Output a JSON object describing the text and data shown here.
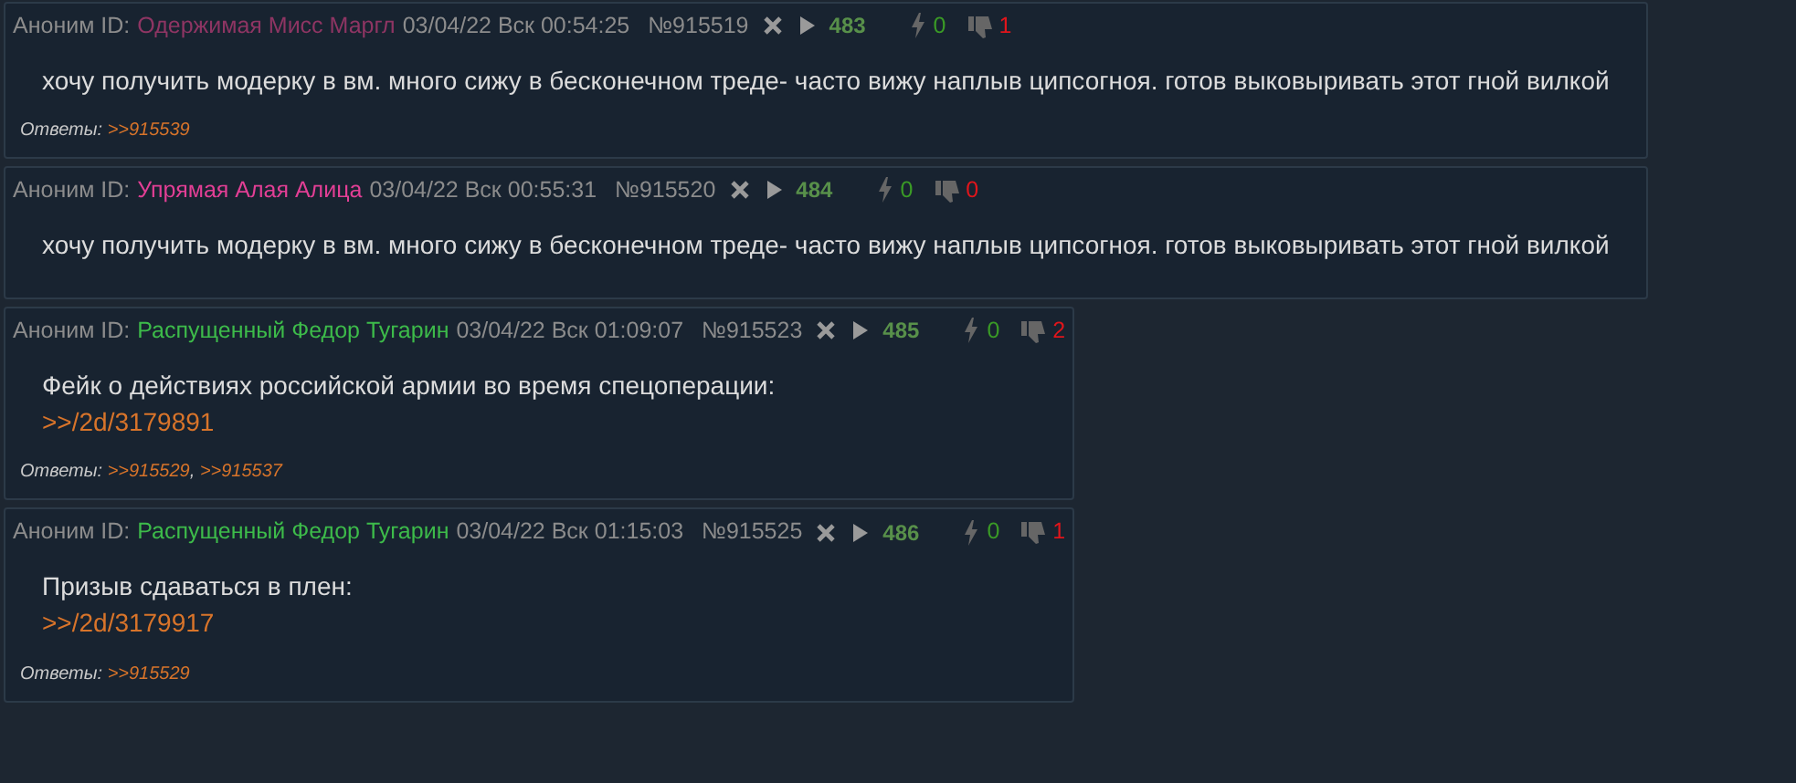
{
  "posts": [
    {
      "author": "Аноним ID:",
      "poster_name": "Одержимая Мисс Маргл",
      "color": "#8e3563",
      "datetime": "03/04/22 Вск 00:54:25",
      "number": "№915519",
      "index": "483",
      "likes": "0",
      "dislikes": "1",
      "body": [
        {
          "kind": "text",
          "text": "хочу получить модерку в вм. много сижу в бесконечном треде- часто вижу наплыв ципсогноя. готов выковыривать этот гной вилкой"
        }
      ],
      "replies_label": "Ответы:",
      "replies": [
        ">>915539"
      ]
    },
    {
      "author": "Аноним ID:",
      "poster_name": "Упрямая Алая Алица",
      "color": "#e23f95",
      "datetime": "03/04/22 Вск 00:55:31",
      "number": "№915520",
      "index": "484",
      "likes": "0",
      "dislikes": "0",
      "body": [
        {
          "kind": "text",
          "text": "хочу получить модерку в вм. много сижу в бесконечном треде- часто вижу наплыв ципсогноя. готов выковыривать этот гной вилкой"
        }
      ]
    },
    {
      "author": "Аноним ID:",
      "poster_name": "Распущенный Федор Тугарин",
      "color": "#3dbb4a",
      "datetime": "03/04/22 Вск 01:09:07",
      "number": "№915523",
      "index": "485",
      "likes": "0",
      "dislikes": "2",
      "body": [
        {
          "kind": "text",
          "text": "Фейк о действиях российской армии во время спецоперации:"
        },
        {
          "kind": "link",
          "text": ">>/2d/3179891"
        }
      ],
      "replies_label": "Ответы:",
      "replies": [
        ">>915529",
        ">>915537"
      ],
      "reply_separator": ","
    },
    {
      "author": "Аноним ID:",
      "poster_name": "Распущенный Федор Тугарин",
      "color": "#3dbb4a",
      "datetime": "03/04/22 Вск 01:15:03",
      "number": "№915525",
      "index": "486",
      "likes": "0",
      "dislikes": "1",
      "body": [
        {
          "kind": "text",
          "text": "Призыв сдаваться в плен:"
        },
        {
          "kind": "link",
          "text": ">>/2d/3179917"
        }
      ],
      "replies_label": "Ответы:",
      "replies": [
        ">>915529"
      ]
    }
  ]
}
